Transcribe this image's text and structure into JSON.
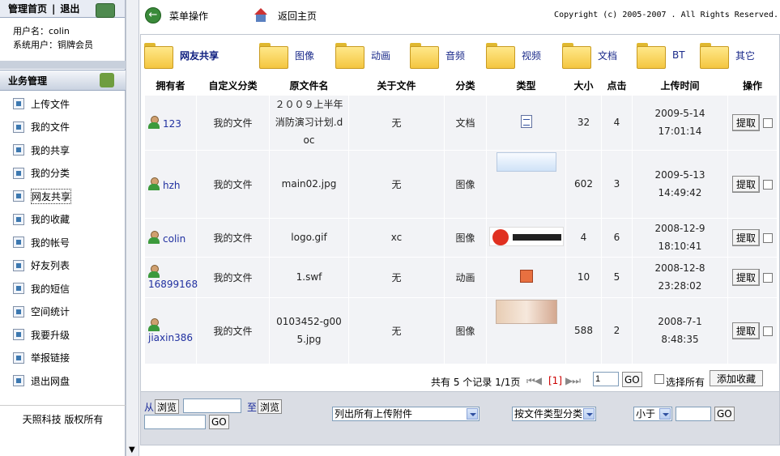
{
  "sidebar": {
    "admin_home": "管理首页",
    "separator": "|",
    "logout": "退出",
    "username_line": "用户名：colin",
    "usertype_line": "系统用户：铜牌会员",
    "business_header": "业务管理",
    "items": [
      {
        "label": "上传文件",
        "icon": "upload-icon"
      },
      {
        "label": "我的文件",
        "icon": "file-icon"
      },
      {
        "label": "我的共享",
        "icon": "share-icon"
      },
      {
        "label": "我的分类",
        "icon": "category-icon"
      },
      {
        "label": "网友共享",
        "icon": "network-share-icon"
      },
      {
        "label": "我的收藏",
        "icon": "favorite-icon"
      },
      {
        "label": "我的帐号",
        "icon": "account-icon"
      },
      {
        "label": "好友列表",
        "icon": "friends-icon"
      },
      {
        "label": "我的短信",
        "icon": "message-icon"
      },
      {
        "label": "空间统计",
        "icon": "stats-icon"
      },
      {
        "label": "我要升级",
        "icon": "upgrade-icon"
      },
      {
        "label": "举报链接",
        "icon": "report-icon"
      },
      {
        "label": "退出网盘",
        "icon": "exit-icon"
      }
    ],
    "active_index": 4,
    "footer": "天照科技 版权所有"
  },
  "topbar": {
    "menu_op": "菜单操作",
    "go_home": "返回主页",
    "copyright": "Copyright (c) 2005-2007 . All Rights Reserved."
  },
  "categories": [
    "网友共享",
    "图像",
    "动画",
    "音频",
    "视频",
    "文档",
    "BT",
    "其它"
  ],
  "table": {
    "headers": [
      "拥有者",
      "自定义分类",
      "原文件名",
      "关于文件",
      "分类",
      "类型",
      "大小",
      "点击",
      "上传时间",
      "操作"
    ],
    "fetch_label": "提取",
    "rows": [
      {
        "owner": "123",
        "custom_cat": "我的文件",
        "filename": "２００９上半年消防演习计划.doc",
        "about": "无",
        "category": "文档",
        "type_thumb": "doc",
        "size": "32",
        "clicks": "4",
        "time": "2009-5-14 17:01:14"
      },
      {
        "owner": "hzh",
        "custom_cat": "我的文件",
        "filename": "main02.jpg",
        "about": "无",
        "category": "图像",
        "type_thumb": "web",
        "size": "602",
        "clicks": "3",
        "time": "2009-5-13 14:49:42"
      },
      {
        "owner": "colin",
        "custom_cat": "我的文件",
        "filename": "logo.gif",
        "about": "xc",
        "category": "图像",
        "type_thumb": "logo",
        "size": "4",
        "clicks": "6",
        "time": "2008-12-9 18:10:41"
      },
      {
        "owner": "16899168",
        "custom_cat": "我的文件",
        "filename": "1.swf",
        "about": "无",
        "category": "动画",
        "type_thumb": "swf",
        "size": "10",
        "clicks": "5",
        "time": "2008-12-8 23:28:02"
      },
      {
        "owner": "jiaxin386",
        "custom_cat": "我的文件",
        "filename": "0103452-g005.jpg",
        "about": "无",
        "category": "图像",
        "type_thumb": "photo",
        "size": "588",
        "clicks": "2",
        "time": "2008-7-1 8:48:35"
      }
    ]
  },
  "pager": {
    "summary": "共有 5 个记录 1/1页",
    "nav_arrows": "⏮◀",
    "nav_arrows_after": "▶⏭",
    "current_page": "[1]",
    "page_input": "1",
    "go_label": "GO",
    "select_all": "选择所有",
    "add_fav": "添加收藏"
  },
  "filter": {
    "from": "从",
    "browse": "浏览",
    "to": "至",
    "go_label": "GO",
    "list_select": "列出所有上传附件",
    "type_select": "按文件类型分类",
    "compare_select": "小于",
    "go_label2": "GO"
  }
}
